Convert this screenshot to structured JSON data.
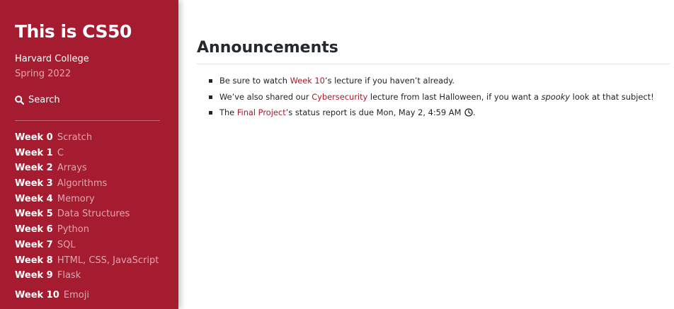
{
  "sidebar": {
    "title": "This is CS50",
    "school": "Harvard College",
    "term": "Spring 2022",
    "search_label": "Search",
    "weeks": [
      {
        "week": "Week 0",
        "topic": "Scratch"
      },
      {
        "week": "Week 1",
        "topic": "C"
      },
      {
        "week": "Week 2",
        "topic": "Arrays"
      },
      {
        "week": "Week 3",
        "topic": "Algorithms"
      },
      {
        "week": "Week 4",
        "topic": "Memory"
      },
      {
        "week": "Week 5",
        "topic": "Data Structures"
      },
      {
        "week": "Week 6",
        "topic": "Python"
      },
      {
        "week": "Week 7",
        "topic": "SQL"
      },
      {
        "week": "Week 8",
        "topic": "HTML, CSS, JavaScript"
      },
      {
        "week": "Week 9",
        "topic": "Flask"
      },
      {
        "week": "Week 10",
        "topic": "Emoji"
      }
    ]
  },
  "main": {
    "heading": "Announcements",
    "announcements": [
      {
        "before": "Be sure to watch ",
        "link": "Week 10",
        "after": "’s lecture if you haven’t already."
      },
      {
        "before": "We’ve also shared our ",
        "link": "Cybersecurity",
        "after": " lecture from last Halloween, if you want a ",
        "em": "spooky",
        "after2": " look at that subject!"
      },
      {
        "before": "The ",
        "link": "Final Project",
        "after": "’s status report is due Mon, May 2, 4:59 AM",
        "after2": "."
      }
    ]
  },
  "colors": {
    "sidebar_bg": "#a51c30",
    "link": "#a51c30",
    "muted_sidebar_text": "#e0a6b0"
  }
}
